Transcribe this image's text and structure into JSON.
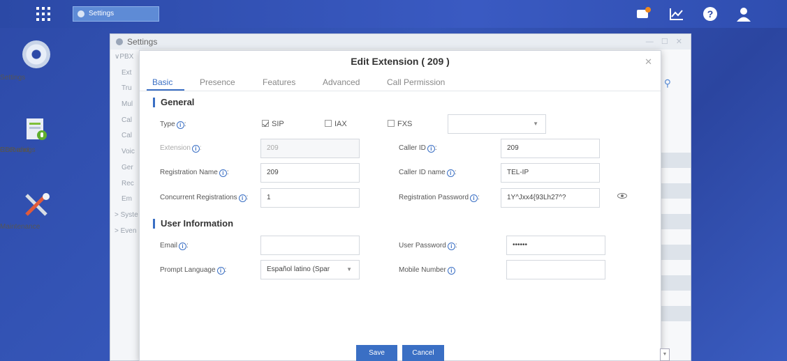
{
  "taskbar": {
    "settings_task_label": "Settings",
    "notification_count": "1"
  },
  "desktop": {
    "settings_label": "Settings",
    "cdr_label_line1": "CDR and",
    "cdr_label_line2": "Recordings",
    "maintenance_label": "Maintenance"
  },
  "window": {
    "title": "Settings",
    "tree": [
      {
        "label": "∨PBX",
        "sub": false
      },
      {
        "label": "Ext",
        "sub": true
      },
      {
        "label": "Tru",
        "sub": true
      },
      {
        "label": "Mul",
        "sub": true
      },
      {
        "label": "Cal",
        "sub": true
      },
      {
        "label": "Cal",
        "sub": true
      },
      {
        "label": "Voic",
        "sub": true
      },
      {
        "label": "Ger",
        "sub": true
      },
      {
        "label": "Rec",
        "sub": true
      },
      {
        "label": "Em",
        "sub": true
      },
      {
        "label": "> Syste",
        "sub": false
      },
      {
        "label": "> Even",
        "sub": false
      }
    ]
  },
  "modal": {
    "title": "Edit Extension ( 209 )",
    "tabs": [
      "Basic",
      "Presence",
      "Features",
      "Advanced",
      "Call Permission"
    ],
    "general_heading": "General",
    "user_info_heading": "User Information",
    "type_label": "Type",
    "type_options": {
      "sip": "SIP",
      "iax": "IAX",
      "fxs": "FXS"
    },
    "fields": {
      "extension": {
        "label": "Extension",
        "value": "209"
      },
      "caller_id": {
        "label": "Caller ID",
        "value": "209"
      },
      "registration_name": {
        "label": "Registration Name",
        "value": "209"
      },
      "caller_id_name": {
        "label": "Caller ID name",
        "value": "TEL-IP"
      },
      "concurrent_registrations": {
        "label": "Concurrent Registrations",
        "value": "1"
      },
      "registration_password": {
        "label": "Registration Password",
        "value": "1Y^Jxx4{93Lh27^?"
      },
      "email": {
        "label": "Email",
        "value": ""
      },
      "user_password": {
        "label": "User Password",
        "value": "••••••"
      },
      "prompt_language": {
        "label": "Prompt Language",
        "value": "Español latino (Spar"
      },
      "mobile_number": {
        "label": "Mobile Number",
        "value": ""
      }
    },
    "save_label": "Save",
    "cancel_label": "Cancel"
  },
  "colors": {
    "accent": "#3a6fc4",
    "desktop_bg": "#2d4aa8"
  }
}
